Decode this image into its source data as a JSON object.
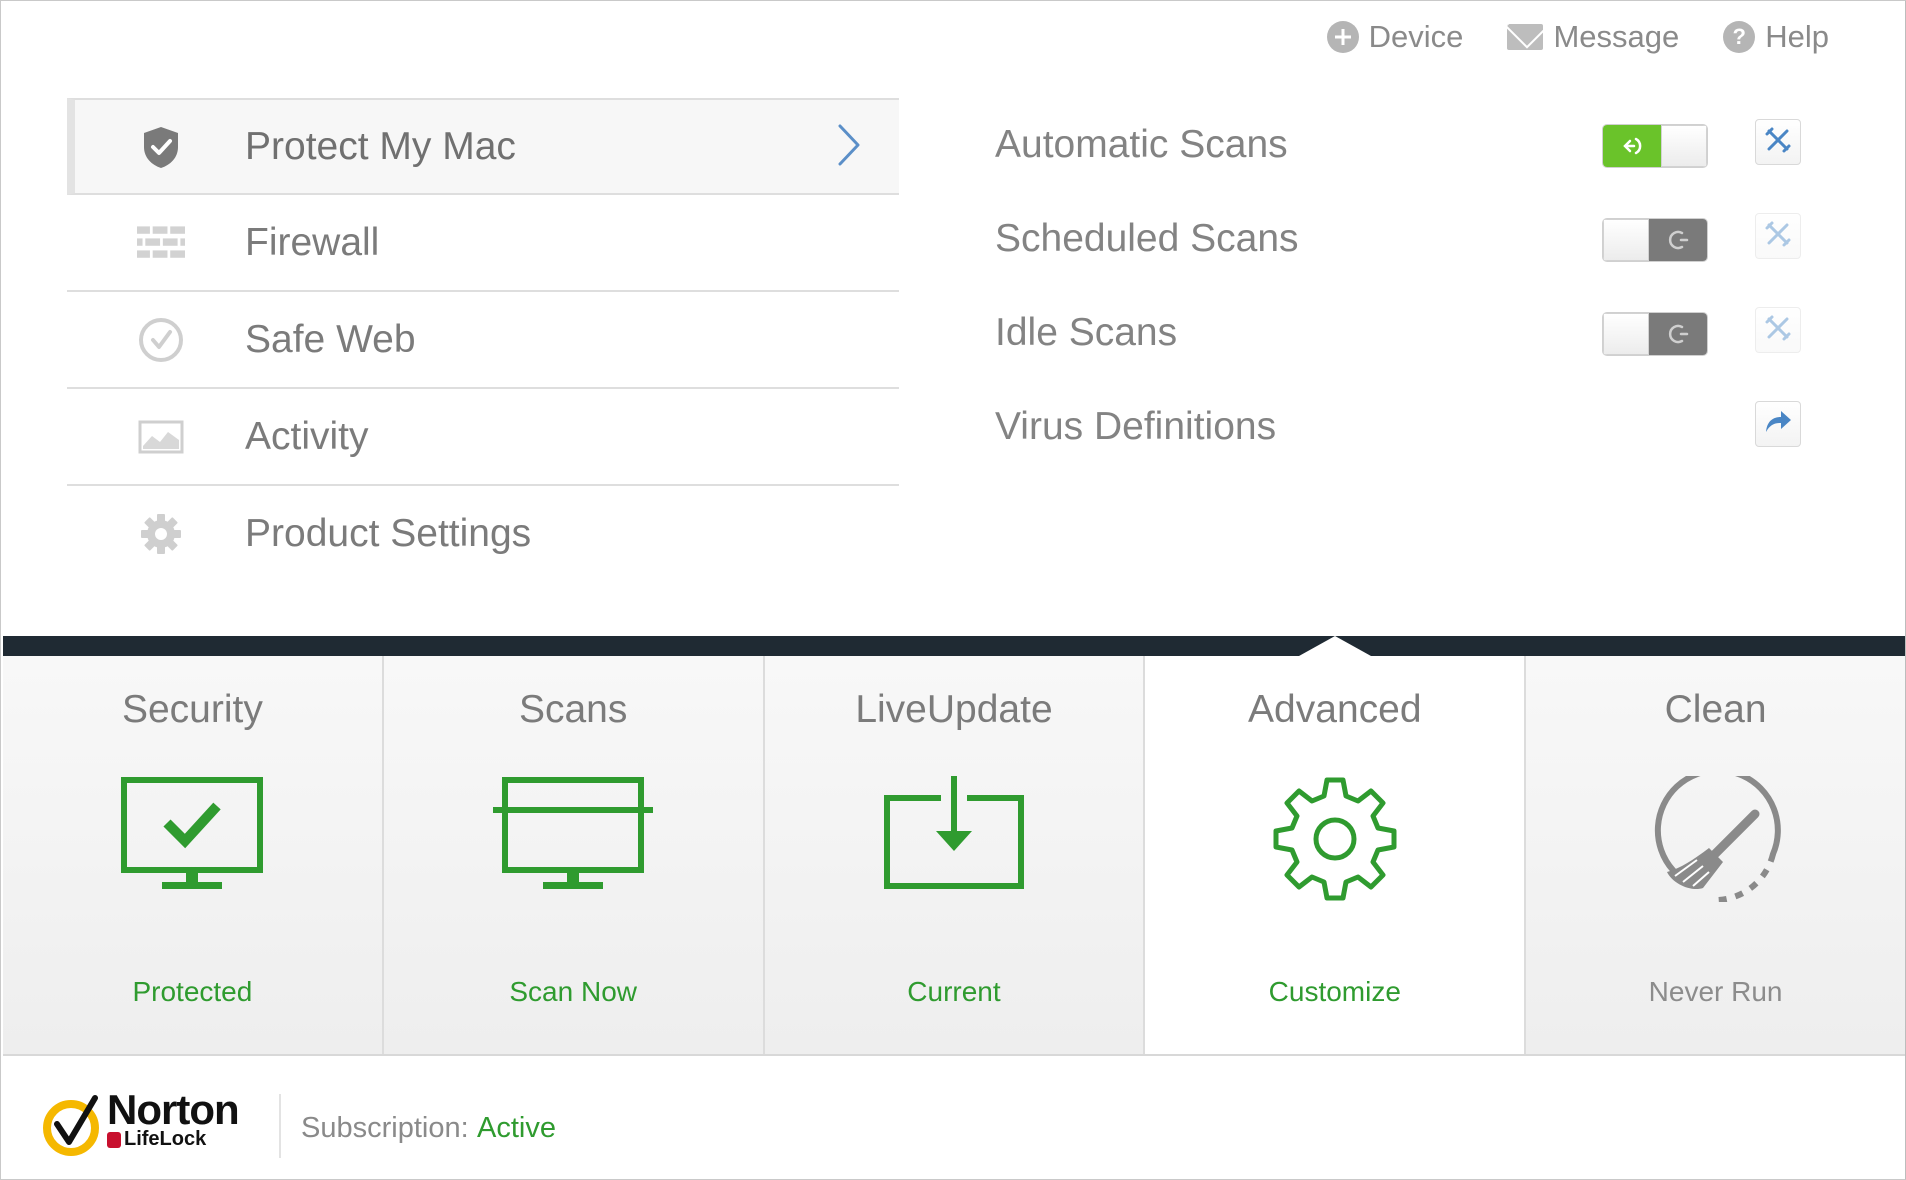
{
  "top_links": {
    "device": "Device",
    "message": "Message",
    "help": "Help"
  },
  "menu": {
    "items": [
      {
        "label": "Protect My Mac",
        "icon": "shield-check-icon",
        "active": true
      },
      {
        "label": "Firewall",
        "icon": "brick-wall-icon"
      },
      {
        "label": "Safe Web",
        "icon": "check-circle-icon"
      },
      {
        "label": "Activity",
        "icon": "activity-chart-icon"
      },
      {
        "label": "Product Settings",
        "icon": "gear-icon"
      }
    ]
  },
  "settings": {
    "rows": [
      {
        "label": "Automatic Scans",
        "toggle": "on",
        "action": "tools-icon"
      },
      {
        "label": "Scheduled Scans",
        "toggle": "off",
        "action": "tools-icon"
      },
      {
        "label": "Idle Scans",
        "toggle": "off",
        "action": "tools-icon"
      },
      {
        "label": "Virus Definitions",
        "action": "share-arrow-icon"
      }
    ]
  },
  "tiles": [
    {
      "title": "Security",
      "status": "Protected",
      "icon": "monitor-check-icon"
    },
    {
      "title": "Scans",
      "status": "Scan Now",
      "icon": "monitor-scan-icon"
    },
    {
      "title": "LiveUpdate",
      "status": "Current",
      "icon": "download-box-icon"
    },
    {
      "title": "Advanced",
      "status": "Customize",
      "icon": "gear-icon",
      "selected": true
    },
    {
      "title": "Clean",
      "status": "Never Run",
      "icon": "broom-clock-icon"
    }
  ],
  "footer": {
    "brand": "Norton",
    "brand_sub": "LifeLock",
    "subscription_label": "Subscription:",
    "subscription_value": "Active"
  },
  "colors": {
    "accent_green": "#2f9b2f",
    "toggle_green": "#6ac32a",
    "separator": "#1f2a33",
    "tool_blue": "#4a86c5",
    "norton_yellow": "#f5b800"
  }
}
